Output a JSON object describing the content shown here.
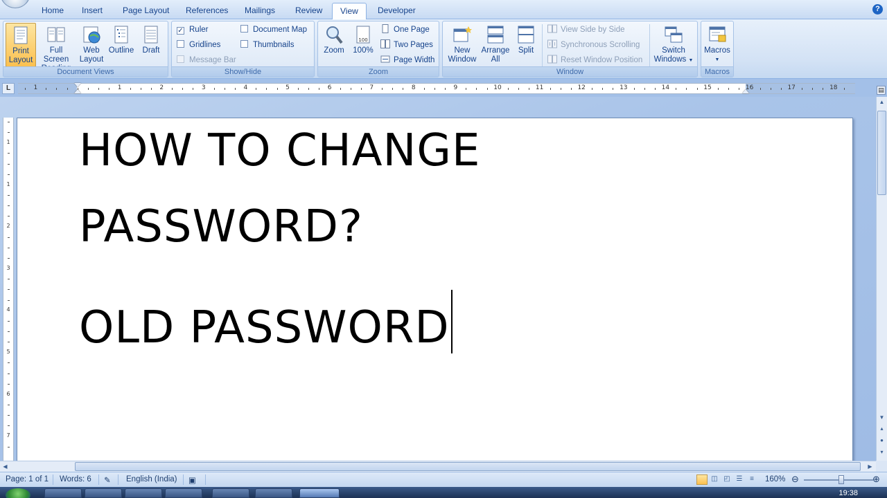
{
  "tabs": [
    {
      "label": "Home"
    },
    {
      "label": "Insert"
    },
    {
      "label": "Page Layout"
    },
    {
      "label": "References"
    },
    {
      "label": "Mailings"
    },
    {
      "label": "Review"
    },
    {
      "label": "View",
      "active": true
    },
    {
      "label": "Developer"
    }
  ],
  "ribbon": {
    "document_views": {
      "label": "Document Views",
      "print_layout": [
        "Print",
        "Layout"
      ],
      "full_screen_reading": [
        "Full Screen",
        "Reading"
      ],
      "web_layout": [
        "Web",
        "Layout"
      ],
      "outline": "Outline",
      "draft": "Draft"
    },
    "show_hide": {
      "label": "Show/Hide",
      "ruler": {
        "label": "Ruler",
        "checked": true
      },
      "gridlines": {
        "label": "Gridlines",
        "checked": false
      },
      "message_bar": {
        "label": "Message Bar",
        "checked": false,
        "disabled": true
      },
      "document_map": {
        "label": "Document Map",
        "checked": false
      },
      "thumbnails": {
        "label": "Thumbnails",
        "checked": false
      }
    },
    "zoom": {
      "label": "Zoom",
      "zoom_button": "Zoom",
      "percent_button": "100%",
      "one_page": "One Page",
      "two_pages": "Two Pages",
      "page_width": "Page Width"
    },
    "window": {
      "label": "Window",
      "new_window": [
        "New",
        "Window"
      ],
      "arrange_all": [
        "Arrange",
        "All"
      ],
      "split": "Split",
      "view_side_by_side": "View Side by Side",
      "synchronous_scrolling": "Synchronous Scrolling",
      "reset_window_position": "Reset Window Position",
      "switch_windows": [
        "Switch",
        "Windows"
      ]
    },
    "macros": {
      "label": "Macros",
      "macros_button": "Macros"
    }
  },
  "ruler": {
    "tab_selector": "L",
    "numbers": [
      "1",
      "1",
      "2",
      "3",
      "4",
      "5",
      "6",
      "7",
      "8",
      "9",
      "10",
      "11",
      "12",
      "13",
      "14",
      "15",
      "16",
      "17",
      "18"
    ],
    "vnumbers": [
      "1",
      "1",
      "2",
      "3",
      "4",
      "5",
      "6",
      "7",
      "8"
    ]
  },
  "document": {
    "lines": [
      "HOW TO CHANGE",
      "PASSWORD?",
      "OLD PASSWORD"
    ]
  },
  "status": {
    "page": "Page: 1 of 1",
    "words": "Words: 6",
    "language": "English (India)",
    "zoom_level": "160%"
  },
  "taskbar": {
    "clock": "19:38"
  },
  "colors": {
    "ribbon_text": "#15428b",
    "workspace_bg": "#a9c4e9",
    "active_button": "#fbc04f"
  }
}
